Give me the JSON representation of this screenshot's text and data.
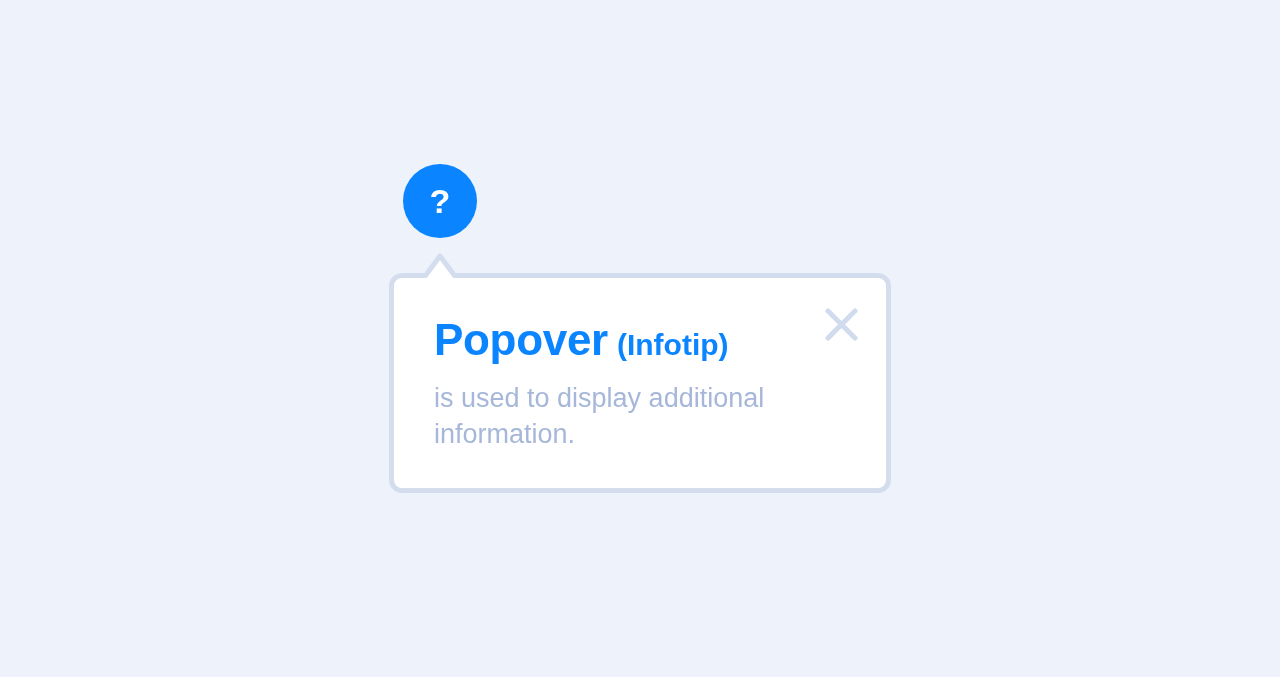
{
  "help_button": {
    "symbol": "?"
  },
  "popover": {
    "title": "Popover",
    "subtitle": "(Infotip)",
    "description": "is used to display additional information."
  }
}
